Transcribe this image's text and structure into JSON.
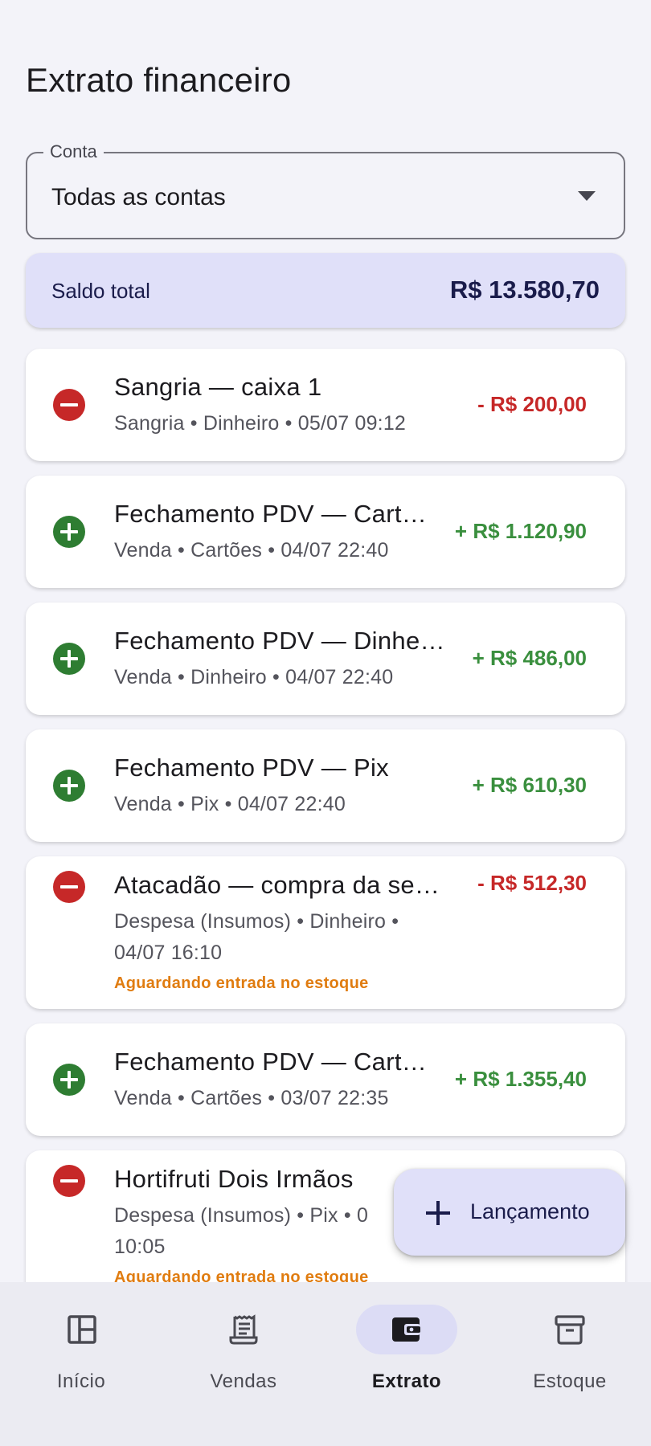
{
  "page": {
    "title": "Extrato financeiro"
  },
  "account": {
    "label": "Conta",
    "value": "Todas as contas"
  },
  "balance": {
    "label": "Saldo total",
    "value": "R$ 13.580,70"
  },
  "transactions": [
    {
      "type": "minus",
      "title": "Sangria — caixa 1",
      "subtitle": "Sangria • Dinheiro • 05/07 09:12",
      "amount": "- R$ 200,00"
    },
    {
      "type": "plus",
      "title": "Fechamento PDV — Cart…",
      "subtitle": "Venda • Cartões • 04/07 22:40",
      "amount": "+ R$ 1.120,90"
    },
    {
      "type": "plus",
      "title": "Fechamento PDV — Dinhe…",
      "subtitle": "Venda • Dinheiro • 04/07 22:40",
      "amount": "+ R$ 486,00"
    },
    {
      "type": "plus",
      "title": "Fechamento PDV — Pix",
      "subtitle": "Venda • Pix • 04/07 22:40",
      "amount": "+ R$ 610,30"
    },
    {
      "type": "minus",
      "title": "Atacadão — compra da se…",
      "subtitle_line1": "Despesa (Insumos) • Dinheiro •",
      "subtitle_line2": "04/07 16:10",
      "status": "Aguardando entrada no estoque",
      "amount": "- R$ 512,30"
    },
    {
      "type": "plus",
      "title": "Fechamento PDV — Cart…",
      "subtitle": "Venda • Cartões • 03/07 22:35",
      "amount": "+ R$ 1.355,40"
    },
    {
      "type": "minus",
      "title": "Hortifruti Dois Irmãos",
      "subtitle_line1": "Despesa (Insumos) • Pix • 0",
      "subtitle_line2": "10:05",
      "status": "Aguardando entrada no estoque"
    }
  ],
  "fab": {
    "label": "Lançamento"
  },
  "nav": [
    {
      "label": "Início",
      "icon": "dashboard-icon",
      "active": false
    },
    {
      "label": "Vendas",
      "icon": "receipt-icon",
      "active": false
    },
    {
      "label": "Extrato",
      "icon": "wallet-icon",
      "active": true
    },
    {
      "label": "Estoque",
      "icon": "archive-box-icon",
      "active": false
    }
  ],
  "colors": {
    "negative": "#c62828",
    "positive": "#3a8f3e",
    "warning": "#e07c10",
    "accent_container": "#e0e0f9"
  }
}
